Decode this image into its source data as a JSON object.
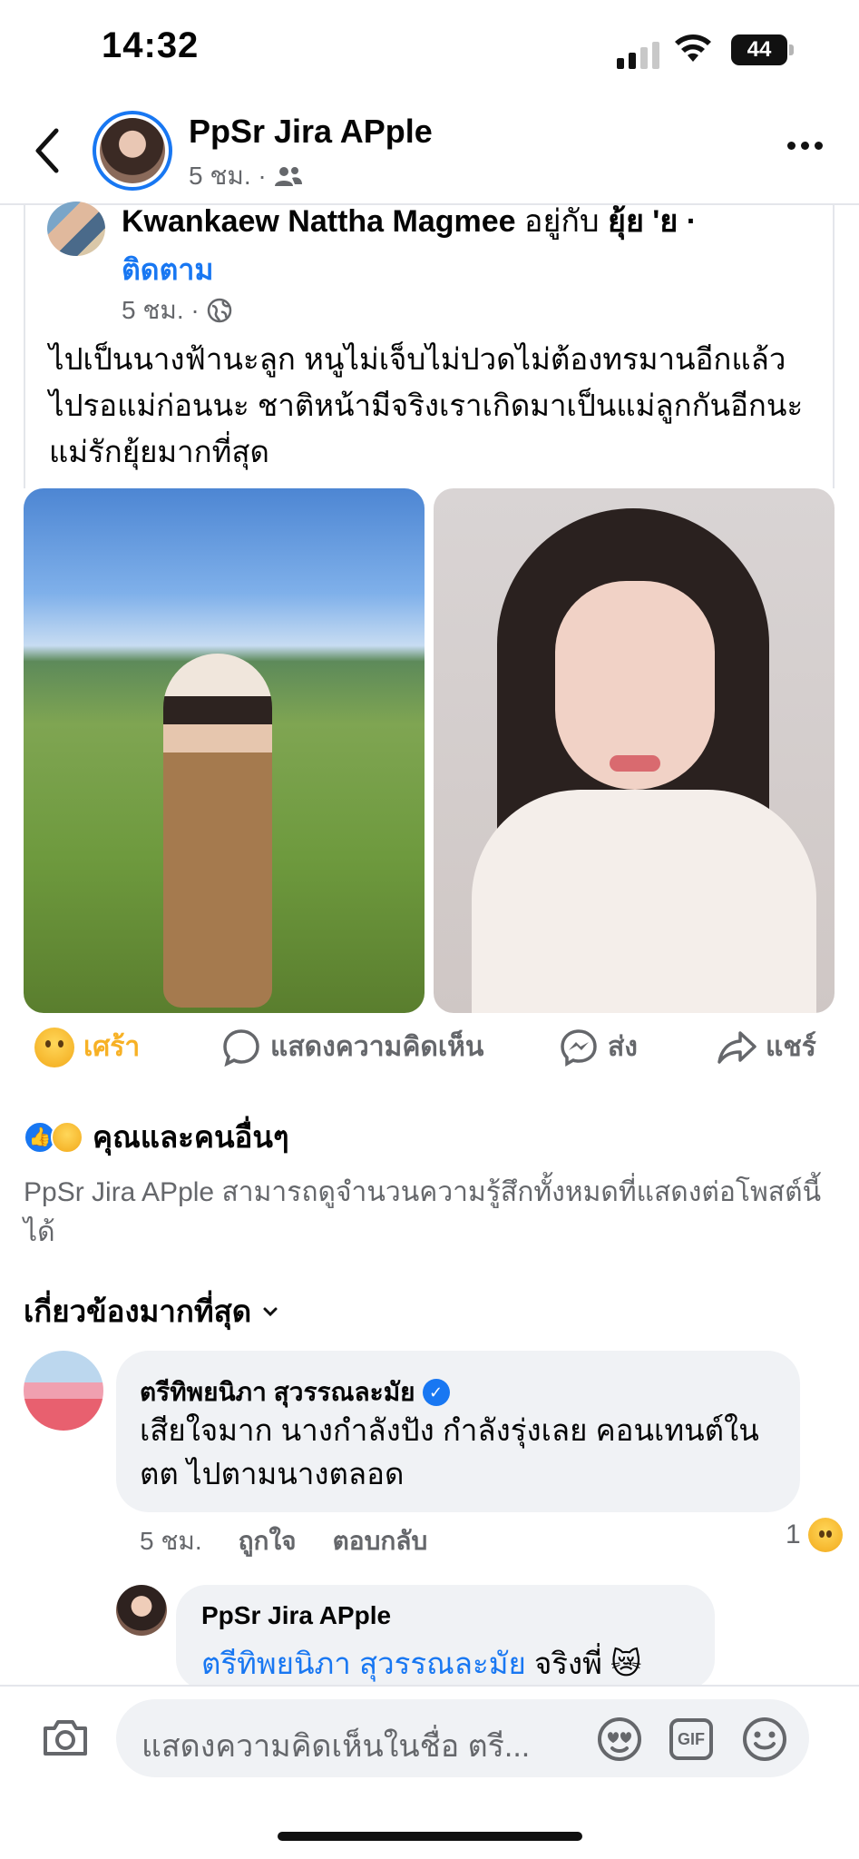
{
  "status_bar": {
    "time": "14:32",
    "battery": "44"
  },
  "header": {
    "name": "PpSr Jira APple",
    "meta": "5 ชม. ·"
  },
  "shared_post": {
    "author": "Kwankaew Nattha Magmee",
    "with_text": "อยู่กับ",
    "tagged": "ยุ้ย 'ย ·",
    "follow_label": "ติดตาม",
    "meta": "5 ชม. ·",
    "text": "ไปเป็นนางฟ้านะลูก หนูไม่เจ็บไม่ปวดไม่ต้องทรมานอีกแล้ว ไปรอแม่ก่อนนะ ชาติหน้ามีจริงเราเกิดมาเป็นแม่ลูกกันอีกนะ แม่รักยุ้ยมากที่สุด"
  },
  "actions": {
    "react_label": "เศร้า",
    "comment_label": "แสดงความคิดเห็น",
    "send_label": "ส่ง",
    "share_label": "แชร์"
  },
  "reactions": {
    "summary": "คุณและคนอื่นๆ"
  },
  "privacy_note": "PpSr Jira APple สามารถดูจำนวนความรู้สึกทั้งหมดที่แสดงต่อโพสต์นี้ได้",
  "sort_label": "เกี่ยวข้องมากที่สุด",
  "comments": [
    {
      "name": "ตรีทิพยนิภา สุวรรณละมัย",
      "text": "เสียใจมาก นางกำลังปัง กำลังรุ่งเลย คอนเทนต์ใน ตต ไปตามนางตลอด",
      "time": "5 ชม.",
      "like_label": "ถูกใจ",
      "reply_label": "ตอบกลับ",
      "reaction_count": "1"
    },
    {
      "name": "PpSr Jira APple",
      "mention": "ตรีทิพยนิภา สุวรรณละมัย",
      "text": "จริงพี่ 😿"
    }
  ],
  "composer": {
    "placeholder": "แสดงความคิดเห็นในชื่อ ตรี...",
    "gif_label": "GIF"
  },
  "colors": {
    "accent": "#1877f2",
    "sad_reaction": "#f7b125",
    "secondary_text": "#65676b",
    "bubble": "#f0f2f5"
  }
}
